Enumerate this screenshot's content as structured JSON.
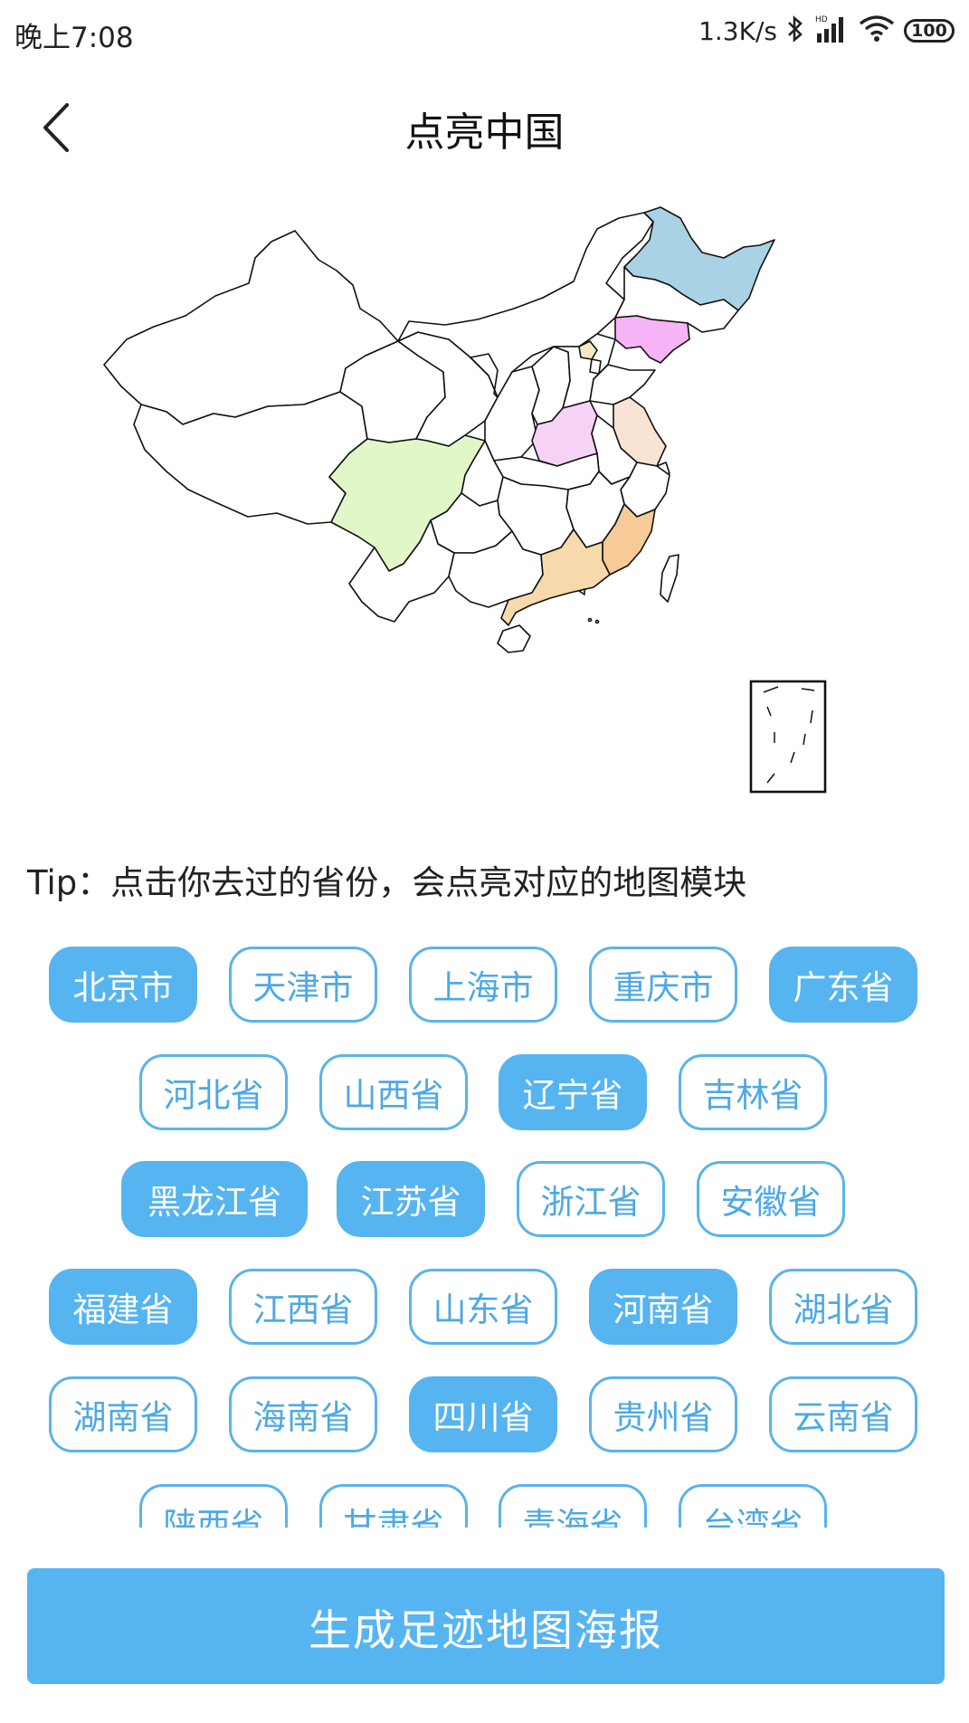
{
  "status_bar": {
    "time": "晚上7:08",
    "net_speed": "1.3K/s",
    "battery": "100",
    "icons": [
      "bluetooth-icon",
      "signal-icon",
      "wifi-icon",
      "battery-icon"
    ]
  },
  "header": {
    "title": "点亮中国",
    "back_icon": "chevron-left-icon"
  },
  "map": {
    "lit_provinces": [
      "黑龙江",
      "辽宁",
      "北京",
      "河南",
      "江苏",
      "四川",
      "福建",
      "广东"
    ],
    "colors": {
      "heilongjiang": "#a9d3e4",
      "liaoning": "#f6b4f6",
      "beijing": "#f7e8c4",
      "henan": "#f6d3f6",
      "jiangsu": "#f8e3d4",
      "sichuan": "#e2f7c7",
      "fujian": "#f7cb97",
      "guangdong": "#f8d9ab",
      "border": "#111111"
    }
  },
  "tip": "Tip：点击你去过的省份，会点亮对应的地图模块",
  "provinces": [
    {
      "label": "北京市",
      "selected": true
    },
    {
      "label": "天津市",
      "selected": false
    },
    {
      "label": "上海市",
      "selected": false
    },
    {
      "label": "重庆市",
      "selected": false
    },
    {
      "label": "广东省",
      "selected": true
    },
    {
      "label": "河北省",
      "selected": false
    },
    {
      "label": "山西省",
      "selected": false
    },
    {
      "label": "辽宁省",
      "selected": true
    },
    {
      "label": "吉林省",
      "selected": false
    },
    {
      "label": "黑龙江省",
      "selected": true
    },
    {
      "label": "江苏省",
      "selected": true
    },
    {
      "label": "浙江省",
      "selected": false
    },
    {
      "label": "安徽省",
      "selected": false
    },
    {
      "label": "福建省",
      "selected": true
    },
    {
      "label": "江西省",
      "selected": false
    },
    {
      "label": "山东省",
      "selected": false
    },
    {
      "label": "河南省",
      "selected": true
    },
    {
      "label": "湖北省",
      "selected": false
    },
    {
      "label": "湖南省",
      "selected": false
    },
    {
      "label": "海南省",
      "selected": false
    },
    {
      "label": "四川省",
      "selected": true
    },
    {
      "label": "贵州省",
      "selected": false
    },
    {
      "label": "云南省",
      "selected": false
    },
    {
      "label": "陕西省",
      "selected": false
    },
    {
      "label": "甘肃省",
      "selected": false
    },
    {
      "label": "青海省",
      "selected": false
    },
    {
      "label": "台湾省",
      "selected": false
    }
  ],
  "generate_button": "生成足迹地图海报",
  "accent_color": "#56b4f0"
}
